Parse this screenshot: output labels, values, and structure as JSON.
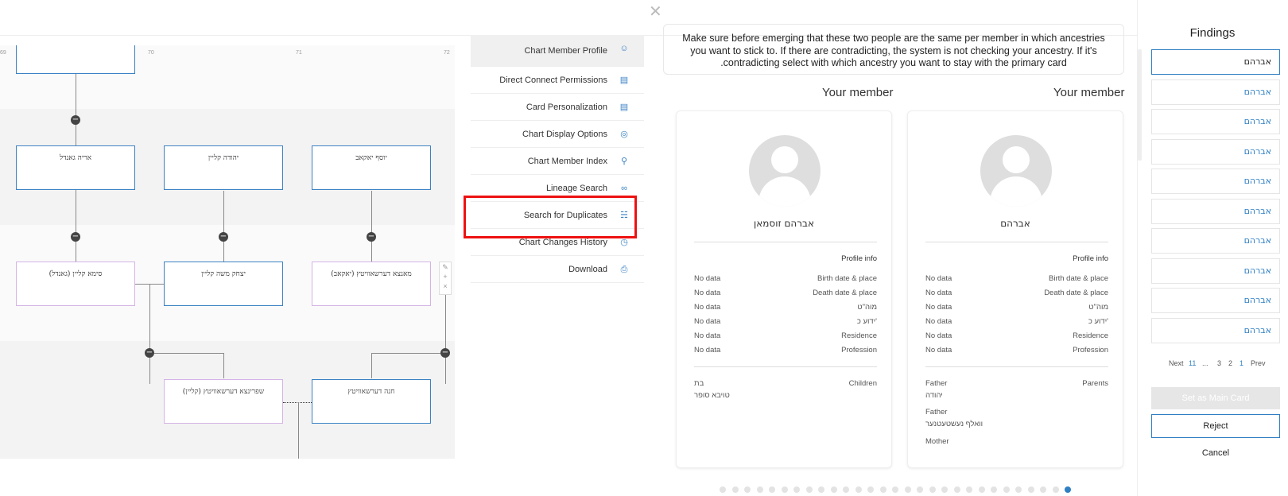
{
  "dialog": {
    "close_icon": "close-icon",
    "notice": "Make sure before emerging that these two people are the same per member in which ancestries you want to stick to. If there are contradicting, the system is not checking your ancestry. If it's .contradicting select with which ancestry you want to stay with the primary card"
  },
  "tree": {
    "ruler": [
      "69",
      "70",
      "71",
      "72"
    ],
    "cards": {
      "c1": "אריה גאנדל",
      "c2": "יהודה קליין",
      "c3": "יוסף יאקאב",
      "c4": "סימא קליין (גאנדל)",
      "c5": "יצחק משה קליין",
      "c6": "מאנצא דערשאוויטץ (יאקאב)",
      "c7": "שפרינצא דערשאוויטץ (קליין)",
      "c8": "חנה דערשאוויטץ"
    }
  },
  "menu": {
    "items": [
      {
        "label": "Chart Member Profile",
        "icon": "user-icon"
      },
      {
        "label": "Direct Connect Permissions",
        "icon": "id-card-icon"
      },
      {
        "label": "Card Personalization",
        "icon": "card-icon"
      },
      {
        "label": "Chart Display Options",
        "icon": "palette-icon"
      },
      {
        "label": "Chart Member Index",
        "icon": "search-icon"
      },
      {
        "label": "Lineage Search",
        "icon": "link-icon"
      },
      {
        "label": "Search for Duplicates",
        "icon": "hierarchy-icon"
      },
      {
        "label": "Chart Changes History",
        "icon": "history-icon"
      },
      {
        "label": "Download",
        "icon": "printer-icon"
      }
    ]
  },
  "members": {
    "left_header": "Your member",
    "right_header": "Your member",
    "left": {
      "name": "אברהם זוסמאן",
      "profile_info": "Profile info",
      "rows": [
        {
          "label": "Birth date & place",
          "value": "No data"
        },
        {
          "label": "Death date & place",
          "value": "No data"
        },
        {
          "label": "מוה\"ט",
          "value": "No data"
        },
        {
          "label": "ידוע כ'",
          "value": "No data"
        },
        {
          "label": "Residence",
          "value": "No data"
        },
        {
          "label": "Profession",
          "value": "No data"
        }
      ],
      "section_label": "Children",
      "relation": "בת",
      "relation_name": "טויבא סופר"
    },
    "right": {
      "name": "אברהם",
      "profile_info": "Profile info",
      "rows": [
        {
          "label": "Birth date & place",
          "value": "No data"
        },
        {
          "label": "Death date & place",
          "value": "No data"
        },
        {
          "label": "מוה\"ט",
          "value": "No data"
        },
        {
          "label": "ידוע כ'",
          "value": "No data"
        },
        {
          "label": "Residence",
          "value": "No data"
        },
        {
          "label": "Profession",
          "value": "No data"
        }
      ],
      "section_label": "Parents",
      "father1_label": "Father",
      "father1_name": "יהודה",
      "father2_label": "Father",
      "father2_name": "וואלף נעשטעטנער",
      "mother_label": "Mother"
    }
  },
  "carousel": {
    "count": 29,
    "active": 28
  },
  "findings": {
    "title": "Findings",
    "items": [
      "אברהם",
      "אברהם",
      "אברהם",
      "אברהם",
      "אברהם",
      "אברהם",
      "אברהם",
      "אברהם",
      "אברהם",
      "אברהם"
    ],
    "pagination": {
      "next": "Next",
      "last": "11",
      "ellipsis": "...",
      "p3": "3",
      "p2": "2",
      "p1": "1",
      "prev": "Prev"
    },
    "set_main": "Set as Main Card",
    "reject": "Reject",
    "cancel": "Cancel"
  },
  "colors": {
    "accent": "#2f7fc3",
    "highlight": "#e11111",
    "male": "#3b82c4",
    "female": "#d4b4e6"
  }
}
